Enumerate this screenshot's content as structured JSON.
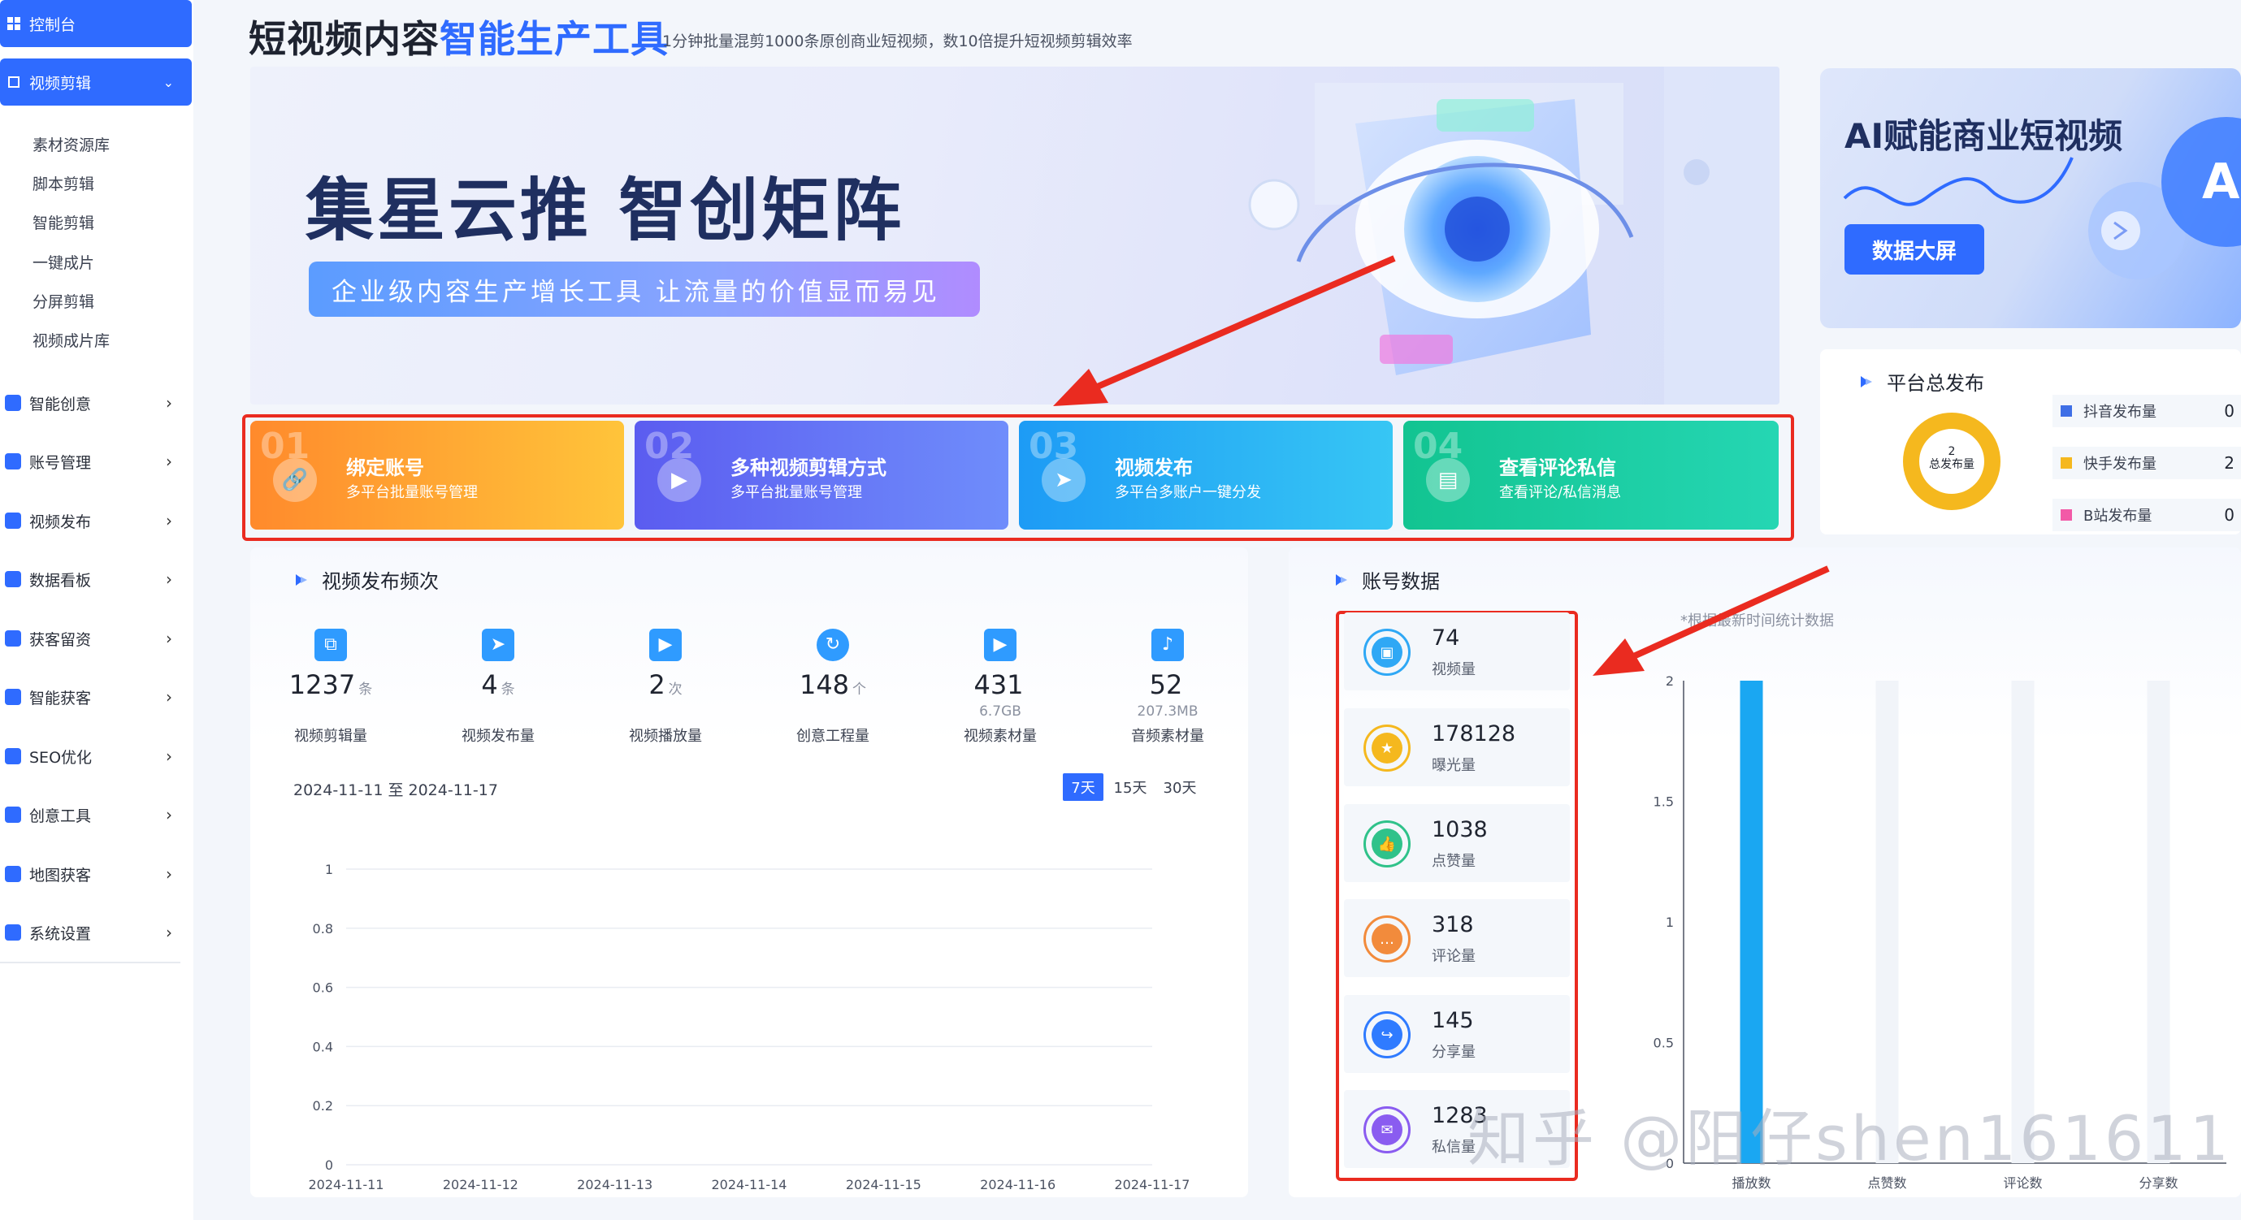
{
  "sidebar": {
    "dashboard": "控制台",
    "video_edit": "视频剪辑",
    "sub_items": [
      "素材资源库",
      "脚本剪辑",
      "智能剪辑",
      "一键成片",
      "分屏剪辑",
      "视频成片库"
    ],
    "items": [
      "智能创意",
      "账号管理",
      "视频发布",
      "数据看板",
      "获客留资",
      "智能获客",
      "SEO优化",
      "创意工具",
      "地图获客",
      "系统设置"
    ]
  },
  "header": {
    "title_part1": "短视频内容",
    "title_part2": "智能生产工具",
    "subtitle": "1分钟批量混剪1000条原创商业短视频，数10倍提升短视频剪辑效率"
  },
  "banner": {
    "headline": "集星云推  智创矩阵",
    "tagline": "企业级内容生产增长工具  让流量的价值显而易见"
  },
  "features": [
    {
      "num": "01",
      "title": "绑定账号",
      "desc": "多平台批量账号管理",
      "icon": "link-icon"
    },
    {
      "num": "02",
      "title": "多种视频剪辑方式",
      "desc": "多平台批量账号管理",
      "icon": "video-icon"
    },
    {
      "num": "03",
      "title": "视频发布",
      "desc": "多平台多账户一键分发",
      "icon": "send-icon"
    },
    {
      "num": "04",
      "title": "查看评论私信",
      "desc": "查看评论/私信消息",
      "icon": "message-icon"
    }
  ],
  "frequency": {
    "title": "视频发布频次",
    "stats": [
      {
        "value": "1237",
        "unit": "条",
        "sub": "",
        "label": "视频剪辑量",
        "color": "#2f9bff",
        "icon": "crop-icon"
      },
      {
        "value": "4",
        "unit": "条",
        "sub": "",
        "label": "视频发布量",
        "color": "#2f9bff",
        "icon": "paper-plane-icon"
      },
      {
        "value": "2",
        "unit": "次",
        "sub": "",
        "label": "视频播放量",
        "color": "#2f9bff",
        "icon": "play-icon"
      },
      {
        "value": "148",
        "unit": "个",
        "sub": "",
        "label": "创意工程量",
        "color": "#2f9bff",
        "icon": "creative-icon"
      },
      {
        "value": "431",
        "unit": "",
        "sub": "6.7GB",
        "label": "视频素材量",
        "color": "#2f9bff",
        "icon": "video-material-icon"
      },
      {
        "value": "52",
        "unit": "",
        "sub": "207.3MB",
        "label": "音频素材量",
        "color": "#2f9bff",
        "icon": "music-icon"
      }
    ],
    "date_range": "2024-11-11 至 2024-11-17",
    "ranges": [
      "7天",
      "15天",
      "30天"
    ]
  },
  "account": {
    "title": "账号数据",
    "note": "*根据最新时间统计数据",
    "items": [
      {
        "value": "74",
        "label": "视频量",
        "color": "#2fa8f5",
        "icon": "video-count-icon"
      },
      {
        "value": "178128",
        "label": "曝光量",
        "color": "#f5b81e",
        "icon": "star-icon"
      },
      {
        "value": "1038",
        "label": "点赞量",
        "color": "#2fc28a",
        "icon": "thumb-up-icon"
      },
      {
        "value": "318",
        "label": "评论量",
        "color": "#f28b3c",
        "icon": "comment-icon"
      },
      {
        "value": "145",
        "label": "分享量",
        "color": "#2f7bff",
        "icon": "share-icon"
      },
      {
        "value": "1283",
        "label": "私信量",
        "color": "#8a5cf0",
        "icon": "mail-icon"
      }
    ]
  },
  "ai_card": {
    "title": "AI赋能商业短视频",
    "button": "数据大屏"
  },
  "platform": {
    "title": "平台总发布",
    "total_value": "2",
    "total_label": "总发布量",
    "rows": [
      {
        "label": "抖音发布量",
        "value": "0",
        "color": "#3f6fe6"
      },
      {
        "label": "快手发布量",
        "value": "2",
        "color": "#f5b81e"
      },
      {
        "label": "B站发布量",
        "value": "0",
        "color": "#f25aa7"
      }
    ]
  },
  "watermark": "知乎 @阳仔shen161611",
  "chart_data": [
    {
      "type": "line",
      "x": [
        "2024-11-11",
        "2024-11-12",
        "2024-11-13",
        "2024-11-14",
        "2024-11-15",
        "2024-11-16",
        "2024-11-17"
      ],
      "series": [
        {
          "values": [
            0,
            0,
            0,
            0,
            0,
            0,
            0
          ]
        }
      ],
      "ylim": [
        0,
        1
      ],
      "yticks": [
        "1",
        "0.8",
        "0.6",
        "0.4",
        "0.2",
        "0"
      ],
      "grid": true,
      "colors": [
        "#b36cf5",
        "#3fb4f5"
      ]
    },
    {
      "type": "bar",
      "categories": [
        "播放数",
        "点赞数",
        "评论数",
        "分享数"
      ],
      "values": [
        2,
        0,
        0,
        0
      ],
      "ylim": [
        0,
        2
      ],
      "yticks": [
        "2",
        "1.5",
        "1",
        "0.5",
        "0"
      ],
      "color": "#1aa7f2"
    }
  ]
}
